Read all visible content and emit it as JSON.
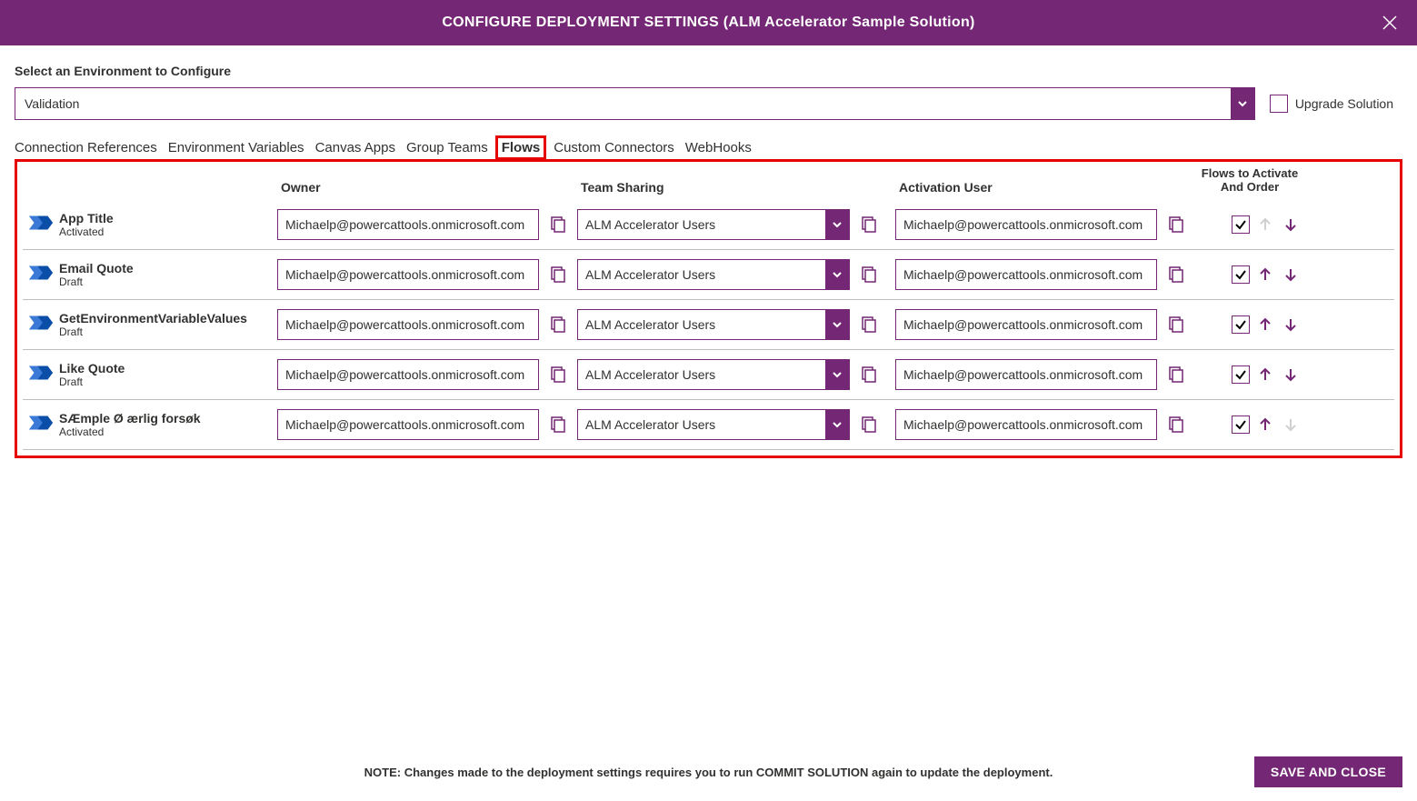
{
  "header": {
    "title": "CONFIGURE DEPLOYMENT SETTINGS (ALM Accelerator Sample Solution)"
  },
  "env": {
    "label": "Select an Environment to Configure",
    "selected": "Validation",
    "upgrade_label": "Upgrade Solution"
  },
  "tabs": {
    "conn_ref": "Connection References",
    "env_vars": "Environment Variables",
    "canvas": "Canvas Apps",
    "group_teams": "Group Teams",
    "flows": "Flows",
    "custom_conn": "Custom Connectors",
    "webhooks": "WebHooks"
  },
  "columns": {
    "owner": "Owner",
    "team_sharing": "Team Sharing",
    "activation_user": "Activation User",
    "order": "Flows to Activate And Order"
  },
  "flows": [
    {
      "name": "App Title",
      "status": "Activated",
      "owner": "Michaelp@powercattools.onmicrosoft.com",
      "team": "ALM Accelerator Users",
      "act_user": "Michaelp@powercattools.onmicrosoft.com",
      "checked": true,
      "up": false,
      "down": true
    },
    {
      "name": "Email Quote",
      "status": "Draft",
      "owner": "Michaelp@powercattools.onmicrosoft.com",
      "team": "ALM Accelerator Users",
      "act_user": "Michaelp@powercattools.onmicrosoft.com",
      "checked": true,
      "up": true,
      "down": true
    },
    {
      "name": "GetEnvironmentVariableValues",
      "status": "Draft",
      "owner": "Michaelp@powercattools.onmicrosoft.com",
      "team": "ALM Accelerator Users",
      "act_user": "Michaelp@powercattools.onmicrosoft.com",
      "checked": true,
      "up": true,
      "down": true
    },
    {
      "name": "Like Quote",
      "status": "Draft",
      "owner": "Michaelp@powercattools.onmicrosoft.com",
      "team": "ALM Accelerator Users",
      "act_user": "Michaelp@powercattools.onmicrosoft.com",
      "checked": true,
      "up": true,
      "down": true
    },
    {
      "name": "SÆmple Ø ærlig forsøk",
      "status": "Activated",
      "owner": "Michaelp@powercattools.onmicrosoft.com",
      "team": "ALM Accelerator Users",
      "act_user": "Michaelp@powercattools.onmicrosoft.com",
      "checked": true,
      "up": true,
      "down": false
    }
  ],
  "footer": {
    "note": "NOTE: Changes made to the deployment settings requires you to run COMMIT SOLUTION again to update the deployment.",
    "save": "SAVE AND CLOSE"
  }
}
